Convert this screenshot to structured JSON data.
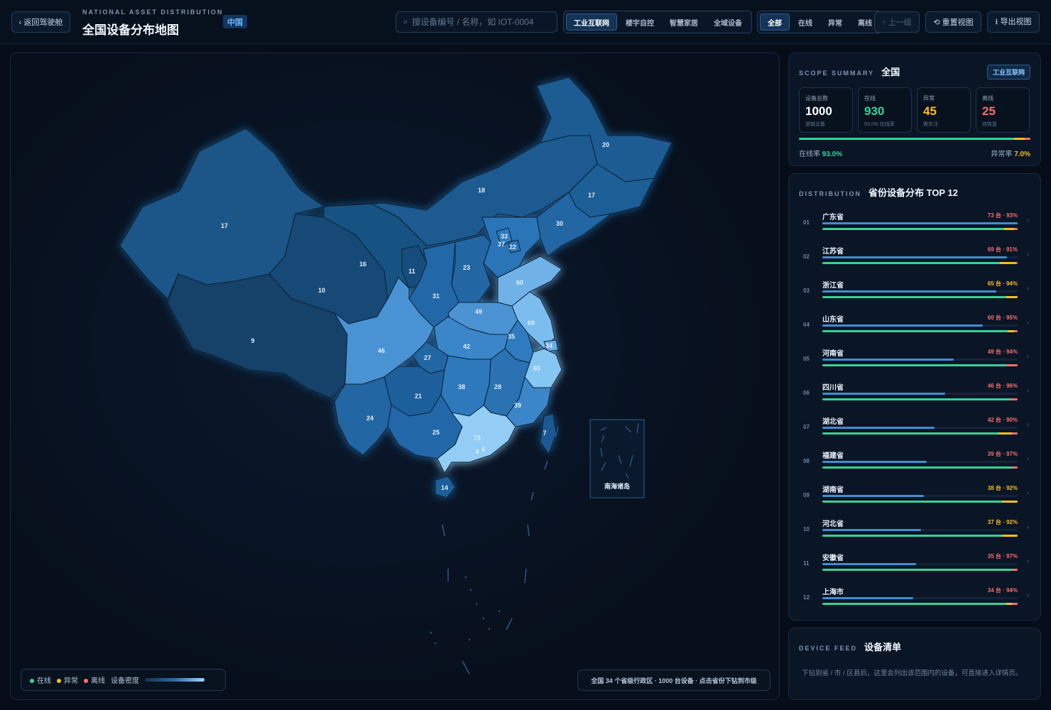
{
  "header": {
    "back_label": "‹ 返回驾驶舱",
    "eyebrow": "NATIONAL ASSET DISTRIBUTION",
    "title": "全国设备分布地图",
    "scope_badge": "中国",
    "search_placeholder": "搜设备编号 / 名称，如 IOT-0004",
    "categories": [
      "工业互联网",
      "楼宇自控",
      "智慧家居",
      "全域设备"
    ],
    "active_category": "工业互联网",
    "statuses": [
      "全部",
      "在线",
      "异常",
      "离线"
    ],
    "active_status": "全部",
    "up_label": "↑ 上一级",
    "reset_label": "⟲ 重置视图",
    "export_label": "⭳ 导出视图"
  },
  "map": {
    "inset_label": "南海诸岛",
    "legend": {
      "online": "在线",
      "abnormal": "异常",
      "offline": "离线",
      "density": "设备密度"
    },
    "summary": "全国 34 个省级行政区 · 1000 台设备 · 点击省份下钻到市级",
    "region_counts": {
      "xinjiang": "17",
      "tibet": "9",
      "qinghai": "10",
      "gansu": "16",
      "ningxia": "11",
      "inner_mongolia": "18",
      "heilongjiang": "20",
      "jilin": "17",
      "liaoning": "30",
      "beijing": "33",
      "tianjin": "22",
      "hebei": "37",
      "shanxi": "23",
      "shaanxi": "31",
      "shandong": "60",
      "henan": "49",
      "jiangsu": "69",
      "anhui": "35",
      "shanghai": "34",
      "hubei": "42",
      "zhejiang": "65",
      "sichuan": "46",
      "chongqing": "27",
      "hunan": "38",
      "jiangxi": "28",
      "fujian": "39",
      "guizhou": "21",
      "yunnan": "24",
      "guangxi": "25",
      "guangdong": "73",
      "hongkong": "6",
      "macau": "4",
      "hainan": "14",
      "taiwan": "7"
    }
  },
  "scope": {
    "eyebrow": "SCOPE SUMMARY",
    "title": "全国",
    "tag": "工业互联网",
    "stats": [
      {
        "label": "设备总数",
        "value": "1000",
        "sub": "逻辑设备",
        "color": "#ffffff"
      },
      {
        "label": "在线",
        "value": "930",
        "sub": "93.0% 在线率",
        "color": "#34d399"
      },
      {
        "label": "异常",
        "value": "45",
        "sub": "需关注",
        "color": "#fbbf24"
      },
      {
        "label": "离线",
        "value": "25",
        "sub": "待恢复",
        "color": "#f87171"
      }
    ],
    "online_rate_label": "在线率",
    "online_rate": "93.0%",
    "abnormal_rate_label": "异常率",
    "abnormal_rate": "7.0%",
    "ratio": {
      "online": 0.93,
      "abnormal": 0.045,
      "offline": 0.025
    }
  },
  "distribution": {
    "eyebrow": "DISTRIBUTION",
    "title": "省份设备分布 TOP 12",
    "rows": [
      {
        "rank": "01",
        "name": "广东省",
        "value": "73 台 · 93%",
        "count": 73,
        "online": 0.93,
        "abnormal": 0.05,
        "tone": "red"
      },
      {
        "rank": "02",
        "name": "江苏省",
        "value": "69 台 · 91%",
        "count": 69,
        "online": 0.91,
        "abnormal": 0.08,
        "tone": "red"
      },
      {
        "rank": "03",
        "name": "浙江省",
        "value": "65 台 · 94%",
        "count": 65,
        "online": 0.94,
        "abnormal": 0.06,
        "tone": "yellow"
      },
      {
        "rank": "04",
        "name": "山东省",
        "value": "60 台 · 95%",
        "count": 60,
        "online": 0.95,
        "abnormal": 0.03,
        "tone": "red"
      },
      {
        "rank": "05",
        "name": "河南省",
        "value": "49 台 · 94%",
        "count": 49,
        "online": 0.94,
        "abnormal": 0.0,
        "tone": "red"
      },
      {
        "rank": "06",
        "name": "四川省",
        "value": "46 台 · 96%",
        "count": 46,
        "online": 0.96,
        "abnormal": 0.0,
        "tone": "red"
      },
      {
        "rank": "07",
        "name": "湖北省",
        "value": "42 台 · 90%",
        "count": 42,
        "online": 0.9,
        "abnormal": 0.07,
        "tone": "red"
      },
      {
        "rank": "08",
        "name": "福建省",
        "value": "39 台 · 97%",
        "count": 39,
        "online": 0.97,
        "abnormal": 0.0,
        "tone": "red"
      },
      {
        "rank": "09",
        "name": "湖南省",
        "value": "38 台 · 92%",
        "count": 38,
        "online": 0.92,
        "abnormal": 0.08,
        "tone": "yellow"
      },
      {
        "rank": "10",
        "name": "河北省",
        "value": "37 台 · 92%",
        "count": 37,
        "online": 0.92,
        "abnormal": 0.08,
        "tone": "yellow"
      },
      {
        "rank": "11",
        "name": "安徽省",
        "value": "35 台 · 97%",
        "count": 35,
        "online": 0.97,
        "abnormal": 0.0,
        "tone": "red"
      },
      {
        "rank": "12",
        "name": "上海市",
        "value": "34 台 · 94%",
        "count": 34,
        "online": 0.94,
        "abnormal": 0.03,
        "tone": "red"
      }
    ]
  },
  "feed": {
    "eyebrow": "DEVICE FEED",
    "title": "设备清单",
    "text": "下钻到省 / 市 / 区县后，这里会列出该范围内的设备，可直接进入详情页。"
  },
  "colors": {
    "online": "#34d399",
    "abnormal": "#fbbf24",
    "offline": "#f87171",
    "accent": "#3f8ed2"
  }
}
